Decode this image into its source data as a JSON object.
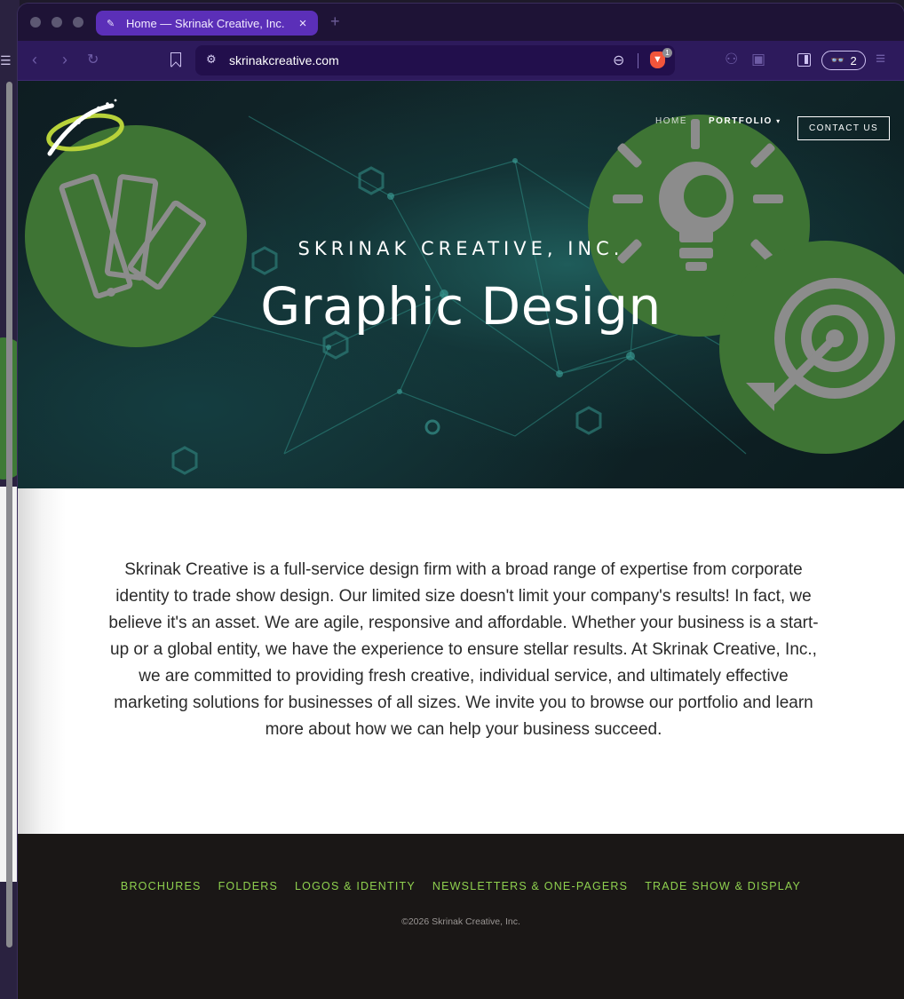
{
  "browser": {
    "tab_title": "Home — Skrinak Creative, Inc.",
    "tab_close": "×",
    "new_tab": "+",
    "url": "skrinakcreative.com",
    "shields_count": "1",
    "wallet_count": "2",
    "accent": "#5b2fb8"
  },
  "site": {
    "nav": {
      "home": "HOME",
      "portfolio": "PORTFOLIO",
      "contact": "CONTACT US"
    },
    "hero": {
      "kicker": "SKRINAK CREATIVE, INC.",
      "headline": "Graphic Design"
    },
    "intro": "Skrinak Creative is a full-service design firm with a broad range of expertise from corporate identity to trade show design. Our limited size doesn't limit your company's results! In fact, we believe it's an asset. We are agile, responsive and affordable. Whether your business is a start-up or a global entity, we have the experience to ensure stellar results. At Skrinak Creative, Inc., we are committed to providing fresh creative, individual service, and ultimately effective marketing solutions for businesses of all sizes. We invite you to browse our portfolio and learn more about how we can help your business succeed.",
    "footer": {
      "links": [
        "BROCHURES",
        "FOLDERS",
        "LOGOS & IDENTITY",
        "NEWSLETTERS & ONE-PAGERS",
        "TRADE SHOW & DISPLAY"
      ],
      "copyright": "©2026 Skrinak Creative, Inc.",
      "link_color": "#8fd14f"
    },
    "brand_green": "#3e7434"
  }
}
